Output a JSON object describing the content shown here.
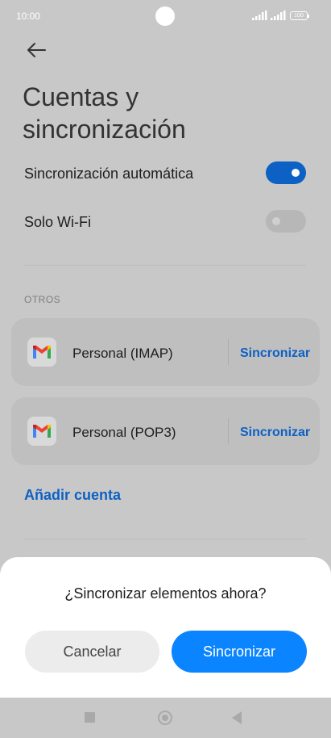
{
  "status_bar": {
    "time": "10:00",
    "battery": "100"
  },
  "header": {
    "back_icon": "arrow-left-icon",
    "title_line1": "Cuentas y",
    "title_line2": "sincronización"
  },
  "settings": {
    "auto_sync": {
      "label": "Sincronización automática",
      "enabled": true
    },
    "wifi_only": {
      "label": "Solo Wi-Fi",
      "enabled": false
    }
  },
  "others": {
    "section_label": "OTROS",
    "accounts": [
      {
        "name": "Personal (IMAP)",
        "action": "Sincronizar",
        "icon": "gmail-icon"
      },
      {
        "name": "Personal (POP3)",
        "action": "Sincronizar",
        "icon": "gmail-icon"
      }
    ],
    "add_account": "Añadir cuenta"
  },
  "dialog": {
    "title": "¿Sincronizar elementos ahora?",
    "cancel_label": "Cancelar",
    "confirm_label": "Sincronizar"
  },
  "colors": {
    "accent": "#0d61c4",
    "primary_button": "#0a84ff"
  }
}
